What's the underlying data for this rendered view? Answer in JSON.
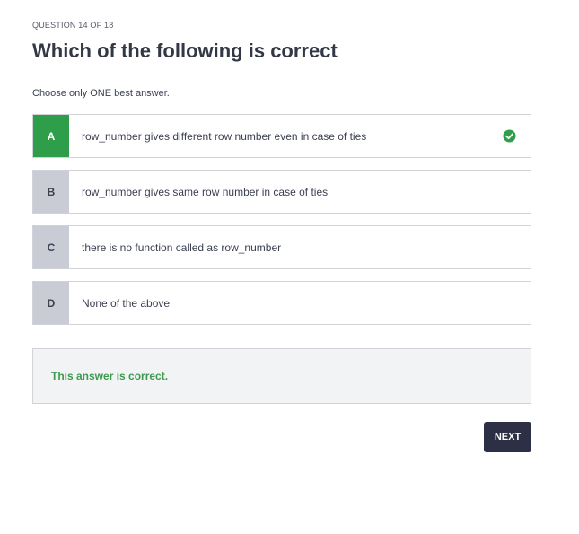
{
  "header": {
    "counter": "QUESTION 14 OF 18",
    "question": "Which of the following is correct"
  },
  "instruction": "Choose only ONE best answer.",
  "options": [
    {
      "letter": "A",
      "text": "row_number gives different row number even in case of ties",
      "correct": true,
      "icon": "check-circle-icon"
    },
    {
      "letter": "B",
      "text": "row_number gives same row number in case of ties",
      "correct": false
    },
    {
      "letter": "C",
      "text": "there is no function called as row_number",
      "correct": false
    },
    {
      "letter": "D",
      "text": "None of the above",
      "correct": false
    }
  ],
  "feedback": {
    "message": "This answer is correct."
  },
  "actions": {
    "next_label": "NEXT"
  },
  "colors": {
    "correct": "#2f9e4a",
    "letter_bg": "#c9ccd4",
    "button_bg": "#2d3044",
    "feedback_text": "#3f9a4f"
  }
}
